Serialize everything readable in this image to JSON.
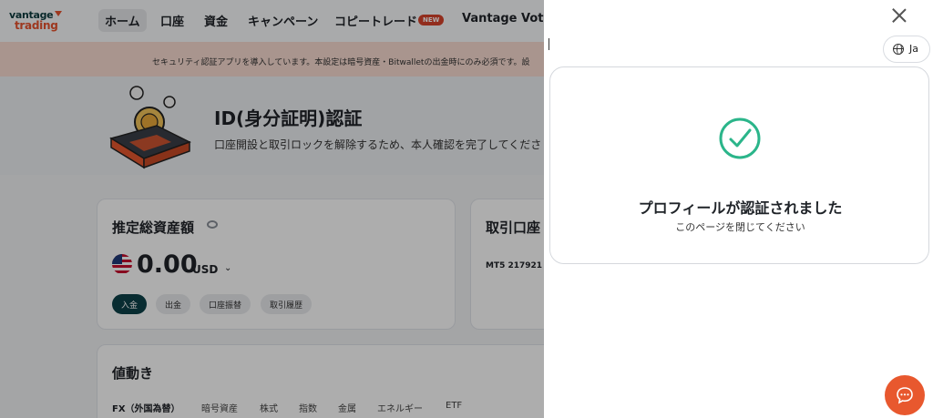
{
  "nav": {
    "logo_line1": "vantage",
    "logo_line2": "trading",
    "items": [
      "ホーム",
      "口座",
      "資金",
      "キャンペーン",
      "コピートレード",
      "Vantage Vote"
    ],
    "new_badge": "NEW"
  },
  "banner": {
    "text": "セキュリティ認証アプリを導入しています。本設定は暗号資産・Bitwalletの出金時にのみ必須です。設"
  },
  "hero": {
    "title": "ID(身分証明)認証",
    "subtitle": "口座開設と取引ロックを解除するため、本人確認を完了してくださ"
  },
  "assets_card": {
    "title": "推定総資産額",
    "balance": "0.00",
    "currency": "USD",
    "actions": [
      "入金",
      "出金",
      "口座振替",
      "取引履歴"
    ]
  },
  "accounts_card": {
    "title": "取引口座",
    "account_line": "MT5  217921"
  },
  "markets_card": {
    "title": "値動き",
    "tabs": [
      "FX（外国為替）",
      "暗号資産",
      "株式",
      "指数",
      "金属",
      "エネルギー",
      "ETF"
    ]
  },
  "panel": {
    "language": "Ja",
    "verified_title": "プロフィールが認証されました",
    "verified_subtitle": "このページを閉じてください"
  },
  "colors": {
    "accent_green": "#2bb58a",
    "brand_orange": "#e8582e",
    "primary_dark": "#0c4149"
  }
}
